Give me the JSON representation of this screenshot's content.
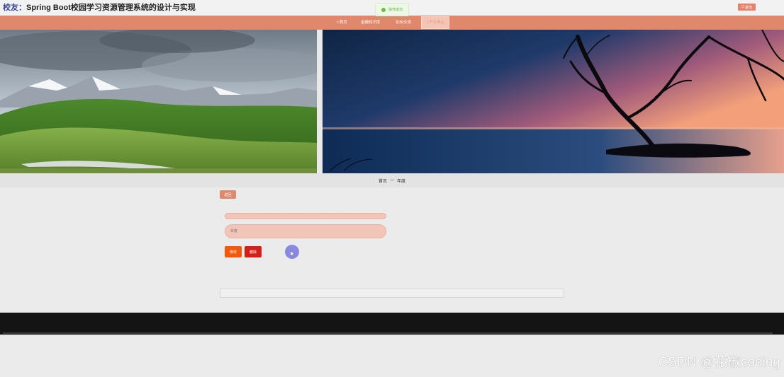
{
  "header": {
    "title_prefix": "校友：",
    "title_main": "Spring Boot校园学习资源管理系统的设计与实现",
    "toast": "操作成功",
    "logout_label": "退出"
  },
  "nav": {
    "items": [
      {
        "label": "☆首页"
      },
      {
        "label": "金融知识库"
      },
      {
        "label": "论坛交流"
      },
      {
        "label": "♀个人中心",
        "active": true
      }
    ]
  },
  "breadcrumb": {
    "home": "首页",
    "separator": "—",
    "current": "年度"
  },
  "form": {
    "back_label": "返回",
    "year_placeholder": "年度",
    "edit_label": "修改",
    "delete_label": "删除"
  },
  "watermark": "CSDN @花椒coding",
  "colors": {
    "nav_bg": "#e0886c",
    "edit_button": "#f2590c",
    "delete_button": "#d31f18",
    "footer_bg": "#141414"
  }
}
